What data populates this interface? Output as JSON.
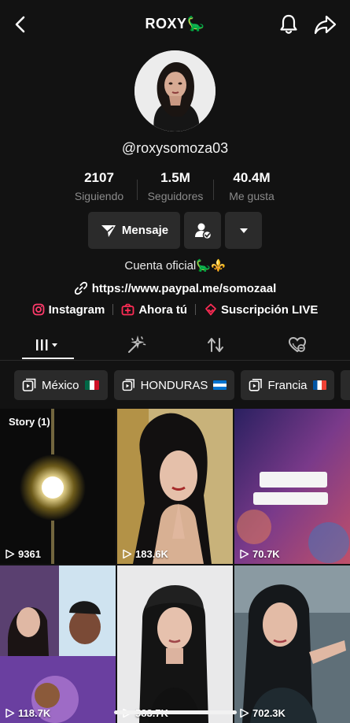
{
  "header": {
    "title": "ROXY",
    "title_emoji": "🦕"
  },
  "profile": {
    "handle": "@roxysomoza03",
    "stats": [
      {
        "value": "2107",
        "label": "Siguiendo"
      },
      {
        "value": "1.5M",
        "label": "Seguidores"
      },
      {
        "value": "40.4M",
        "label": "Me gusta"
      }
    ],
    "message_label": "Mensaje",
    "bio": "Cuenta oficial🦕⚜️",
    "link": "https://www.paypal.me/somozaal",
    "pills": [
      {
        "label": "Instagram",
        "icon": "instagram-icon"
      },
      {
        "label": "Ahora tú",
        "icon": "ahora-tu-icon"
      },
      {
        "label": "Suscripción LIVE",
        "icon": "subscription-icon"
      }
    ]
  },
  "tabs": [
    {
      "icon": "videos-grid-icon",
      "active": true
    },
    {
      "icon": "sparkle-wand-icon",
      "active": false
    },
    {
      "icon": "repost-icon",
      "active": false
    },
    {
      "icon": "hidden-likes-icon",
      "active": false
    }
  ],
  "playlists": [
    {
      "label": "México",
      "flag": "mexico"
    },
    {
      "label": "HONDURAS",
      "flag": "honduras"
    },
    {
      "label": "Francia",
      "flag": "france"
    }
  ],
  "videos": [
    {
      "views": "9361",
      "badge": "Story (1)"
    },
    {
      "views": "183.6K",
      "badge": ""
    },
    {
      "views": "70.7K",
      "badge": ""
    },
    {
      "views": "118.7K",
      "badge": ""
    },
    {
      "views": "583.7K",
      "badge": ""
    },
    {
      "views": "702.3K",
      "badge": ""
    }
  ],
  "colors": {
    "background": "#121212",
    "button": "#2b2b2b",
    "muted_text": "#8a8a8a",
    "instagram": "#ff3b6b",
    "accent_red": "#fe2c55"
  }
}
